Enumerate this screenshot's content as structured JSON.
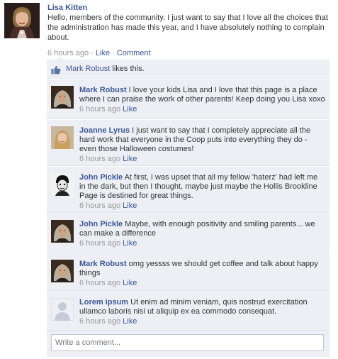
{
  "post": {
    "author": "Lisa Kitten",
    "text": "Hello, members of the community. I just want to say that I love all the choices that the administration has made this year, and I have absolutely nothing to complain about.",
    "time": "6 hours ago",
    "sep": " · ",
    "like_label": "Like",
    "comment_label": "Comment"
  },
  "likes": {
    "name": "Mark Robust",
    "suffix": " likes this."
  },
  "comments": [
    {
      "author": "Mark Robust",
      "text": " I love your kids Lisa and I love that this page is a place where I can praise the work of other parents! Keep doing you Lisa xoxo",
      "time": "6 hours ago",
      "like": "Like"
    },
    {
      "author": "Joanne Lyrus",
      "text": " I just want to say that I completely appreciate all the hard work that everyone in the Coop puts into everything they do - even those Halloween costumes!",
      "time": "6 hours ago",
      "like": "Like"
    },
    {
      "author": "John Pickle",
      "text": " At first, I was upset that all my fellow 'haterz' had left me in the dark, but then I thought, maybe just maybe the Hollis Brookline Page is destined for great things.",
      "time": "6 hours ago",
      "like": "Like"
    },
    {
      "author": "John Pickle",
      "text": " Maybe, with enough positivity and smiling parents... we can make a difference",
      "time": "6 hours ago",
      "like": "Like"
    },
    {
      "author": "Mark Robust",
      "text": " omg yessss we should get coffee and talk about happy things",
      "time": "6 hours ago",
      "like": "Like"
    },
    {
      "author": "Lorem ipsum",
      "text": " Ut enim ad minim veniam, quis nostrud exercitation ullamco laboris nisi ut aliquip ex ea commodo consequat.",
      "time": "6 hours ago",
      "like": "Like"
    }
  ],
  "composer": {
    "placeholder": "Write a comment..."
  },
  "colors": {
    "link": "#3b5998",
    "ufi_bg": "#edeff4",
    "meta": "#999999"
  }
}
